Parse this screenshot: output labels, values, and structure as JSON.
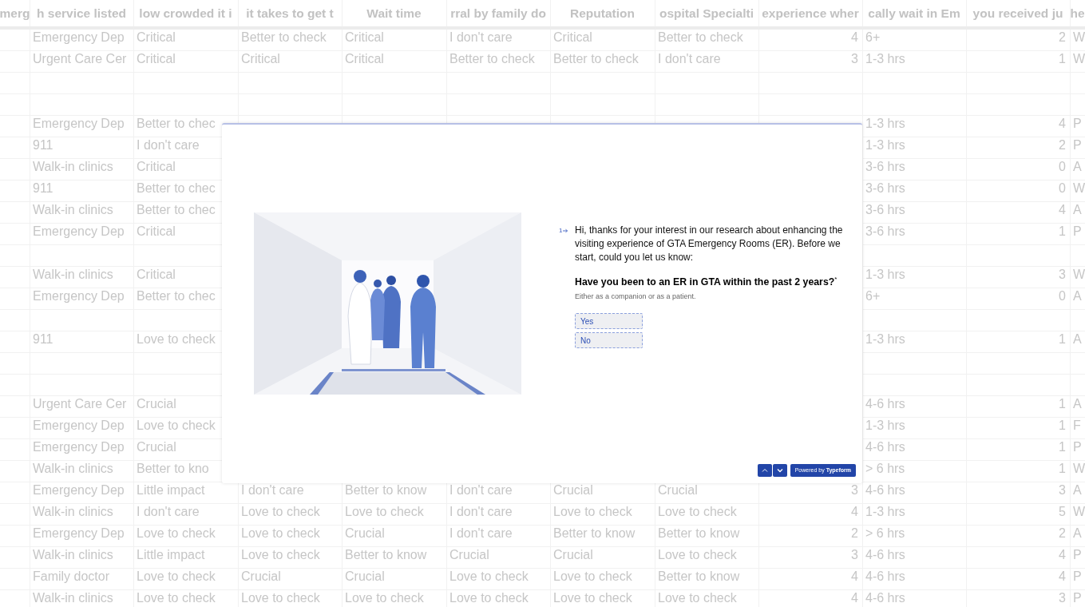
{
  "table": {
    "columns": [
      {
        "label": "merg",
        "kind": "text"
      },
      {
        "label": "h service listed",
        "kind": "text"
      },
      {
        "label": "low crowded it i",
        "kind": "text"
      },
      {
        "label": "it takes to get t",
        "kind": "text"
      },
      {
        "label": "Wait time",
        "kind": "text"
      },
      {
        "label": "rral by family do",
        "kind": "text"
      },
      {
        "label": "Reputation",
        "kind": "text"
      },
      {
        "label": "ospital Specialti",
        "kind": "text"
      },
      {
        "label": "experience wher",
        "kind": "number"
      },
      {
        "label": "cally wait in Em",
        "kind": "text"
      },
      {
        "label": "you received ju",
        "kind": "number"
      },
      {
        "label": "he",
        "kind": "text"
      }
    ],
    "rows": [
      {
        "cells": [
          null,
          "Emergency Dep",
          "Critical",
          "Better to check",
          "Critical",
          "I don't care",
          "Critical",
          "Better to check",
          "4",
          "6+",
          "2",
          "W"
        ]
      },
      {
        "cells": [
          null,
          "Urgent Care Cer",
          "Critical",
          "Critical",
          "Critical",
          "Better to check",
          "Better to check",
          "I don't care",
          "3",
          "1-3 hrs",
          "1",
          "W"
        ]
      },
      {
        "cells": [
          null,
          null,
          null,
          null,
          null,
          null,
          null,
          null,
          null,
          null,
          null,
          null
        ]
      },
      {
        "cells": [
          null,
          null,
          null,
          null,
          null,
          null,
          null,
          null,
          null,
          null,
          null,
          null
        ]
      },
      {
        "cells": [
          null,
          "Emergency Dep",
          "Better to chec",
          null,
          null,
          null,
          null,
          null,
          null,
          "1-3 hrs",
          "4",
          "P"
        ]
      },
      {
        "cells": [
          null,
          "911",
          "I don't care",
          null,
          null,
          null,
          null,
          null,
          null,
          "1-3 hrs",
          "2",
          "P"
        ]
      },
      {
        "cells": [
          null,
          "Walk-in clinics",
          "Critical",
          null,
          null,
          null,
          null,
          null,
          null,
          "3-6 hrs",
          "0",
          "A"
        ]
      },
      {
        "cells": [
          null,
          "911",
          "Better to chec",
          null,
          null,
          null,
          null,
          null,
          null,
          "3-6 hrs",
          "0",
          "W"
        ]
      },
      {
        "cells": [
          null,
          "Walk-in clinics",
          "Better to chec",
          null,
          null,
          null,
          null,
          null,
          null,
          "3-6 hrs",
          "4",
          "A"
        ]
      },
      {
        "cells": [
          null,
          "Emergency Dep",
          "Critical",
          null,
          null,
          null,
          null,
          null,
          null,
          "3-6 hrs",
          "1",
          "P"
        ]
      },
      {
        "cells": [
          null,
          null,
          null,
          null,
          null,
          null,
          null,
          null,
          null,
          null,
          null,
          null
        ]
      },
      {
        "cells": [
          null,
          "Walk-in clinics",
          "Critical",
          null,
          null,
          null,
          null,
          null,
          null,
          "1-3 hrs",
          "3",
          "W"
        ]
      },
      {
        "cells": [
          null,
          "Emergency Dep",
          "Better to chec",
          null,
          null,
          null,
          null,
          null,
          null,
          "6+",
          "0",
          "A"
        ]
      },
      {
        "cells": [
          null,
          null,
          null,
          null,
          null,
          null,
          null,
          null,
          null,
          null,
          null,
          null
        ]
      },
      {
        "cells": [
          null,
          "911",
          "Love to check",
          null,
          null,
          null,
          null,
          null,
          null,
          "1-3 hrs",
          "1",
          "A"
        ]
      },
      {
        "cells": [
          null,
          null,
          null,
          null,
          null,
          null,
          null,
          null,
          null,
          null,
          null,
          null
        ]
      },
      {
        "cells": [
          null,
          null,
          null,
          null,
          null,
          null,
          null,
          null,
          null,
          null,
          null,
          null
        ]
      },
      {
        "cells": [
          null,
          "Urgent Care Cer",
          "Crucial",
          null,
          null,
          null,
          null,
          null,
          null,
          "4-6 hrs",
          "1",
          "A"
        ]
      },
      {
        "cells": [
          null,
          "Emergency Dep",
          "Love to check",
          null,
          null,
          null,
          null,
          null,
          null,
          "1-3 hrs",
          "1",
          "F"
        ]
      },
      {
        "cells": [
          null,
          "Emergency Dep",
          "Crucial",
          null,
          null,
          null,
          null,
          null,
          null,
          "4-6 hrs",
          "1",
          "P"
        ]
      },
      {
        "cells": [
          null,
          "Walk-in clinics",
          "Better to kno",
          null,
          null,
          null,
          null,
          null,
          null,
          "> 6 hrs",
          "1",
          "W"
        ]
      },
      {
        "cells": [
          null,
          "Emergency Dep",
          "Little impact",
          "I don't care",
          "Better to know",
          "I don't care",
          "Crucial",
          "Crucial",
          "3",
          "4-6 hrs",
          "3",
          "A"
        ]
      },
      {
        "cells": [
          null,
          "Walk-in clinics",
          "I don't care",
          "Love to check",
          "Love to check",
          "I don't care",
          "Love to check",
          "Love to check",
          "4",
          "1-3 hrs",
          "5",
          "W"
        ]
      },
      {
        "cells": [
          null,
          "Emergency Dep",
          "Love to check",
          "Love to check",
          "Crucial",
          "I don't care",
          "Better to know",
          "Better to know",
          "2",
          "> 6 hrs",
          "2",
          "A"
        ]
      },
      {
        "cells": [
          null,
          "Walk-in clinics",
          "Little impact",
          "Love to check",
          "Better to know",
          "Crucial",
          "Crucial",
          "Love to check",
          "3",
          "4-6 hrs",
          "4",
          "P"
        ]
      },
      {
        "cells": [
          null,
          "Family doctor",
          "Love to check",
          "Crucial",
          "Crucial",
          "Love to check",
          "Love to check",
          "Better to know",
          "4",
          "4-6 hrs",
          "4",
          "P"
        ]
      },
      {
        "cells": [
          null,
          "Walk-in clinics",
          "Love to check",
          "Love to check",
          "Love to check",
          "Love to check",
          "Love to check",
          "Love to check",
          "4",
          "4-6 hrs",
          "3",
          "P"
        ]
      }
    ]
  },
  "survey": {
    "question_number": "1",
    "intro": "Hi, thanks for your interest in our research about enhancing the visiting experience of GTA Emergency Rooms (ER). Before we start, could you let us know:",
    "question": "Have you been to an ER in GTA within the past 2 years?",
    "required_mark": "*",
    "description": "Either as a companion or as a patient.",
    "options": [
      {
        "label": "Yes",
        "selected": false
      },
      {
        "label": "No",
        "selected": false
      }
    ],
    "powered_by": "Powered by **Typeform**"
  }
}
